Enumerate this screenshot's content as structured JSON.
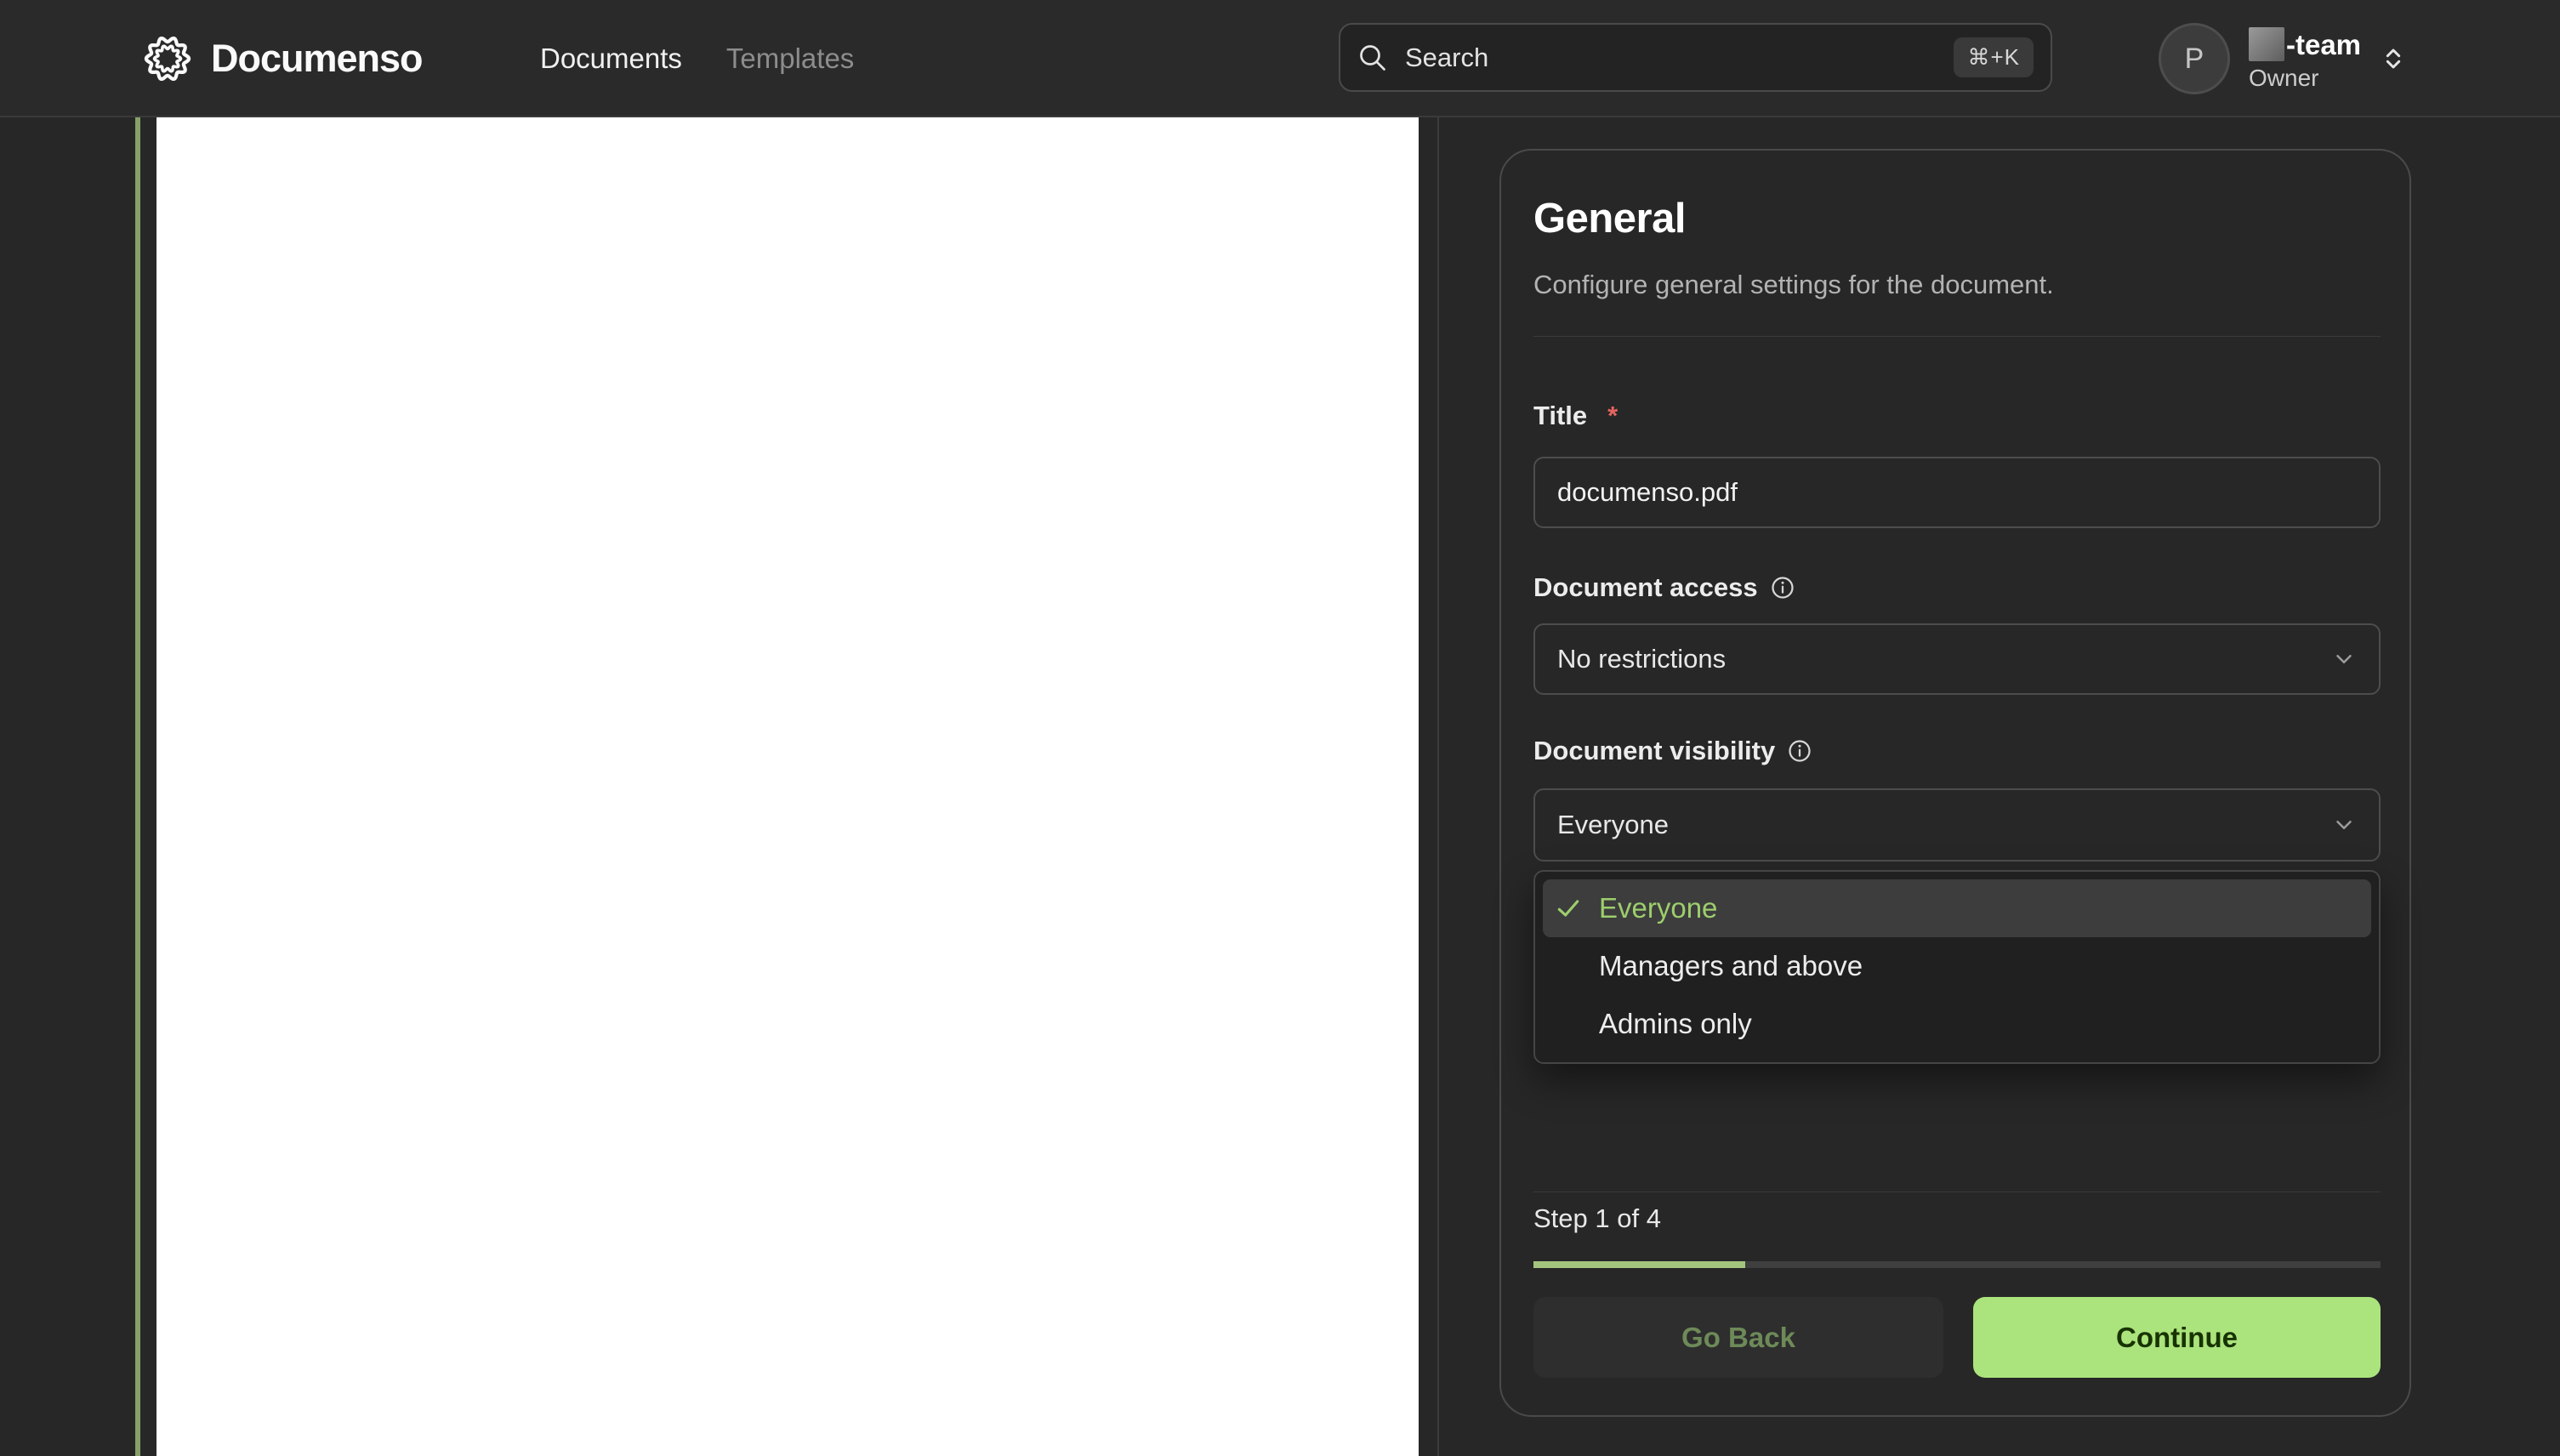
{
  "brand": {
    "name": "Documenso"
  },
  "nav": {
    "items": [
      {
        "label": "Documents",
        "active": true
      },
      {
        "label": "Templates",
        "active": false
      }
    ]
  },
  "search": {
    "placeholder": "Search",
    "shortcut": "⌘+K"
  },
  "user": {
    "avatar_initial": "P",
    "team_name_suffix": "-team",
    "role": "Owner"
  },
  "panel": {
    "title": "General",
    "subtitle": "Configure general settings for the document.",
    "title_field": {
      "label": "Title",
      "required_marker": "*",
      "value": "documenso.pdf"
    },
    "access_field": {
      "label": "Document access",
      "value": "No restrictions"
    },
    "visibility_field": {
      "label": "Document visibility",
      "value": "Everyone"
    },
    "visibility_options": [
      {
        "label": "Everyone",
        "selected": true
      },
      {
        "label": "Managers and above",
        "selected": false
      },
      {
        "label": "Admins only",
        "selected": false
      }
    ],
    "stepper": {
      "label": "Step 1 of 4",
      "progress_percent": 25
    },
    "actions": {
      "back_label": "Go Back",
      "continue_label": "Continue"
    }
  },
  "colors": {
    "accent_green": "#abe37d",
    "progress_green": "#a3c57e",
    "option_green": "#9dce6d",
    "page_edge_green": "#87a069",
    "required_red": "#e56560"
  }
}
